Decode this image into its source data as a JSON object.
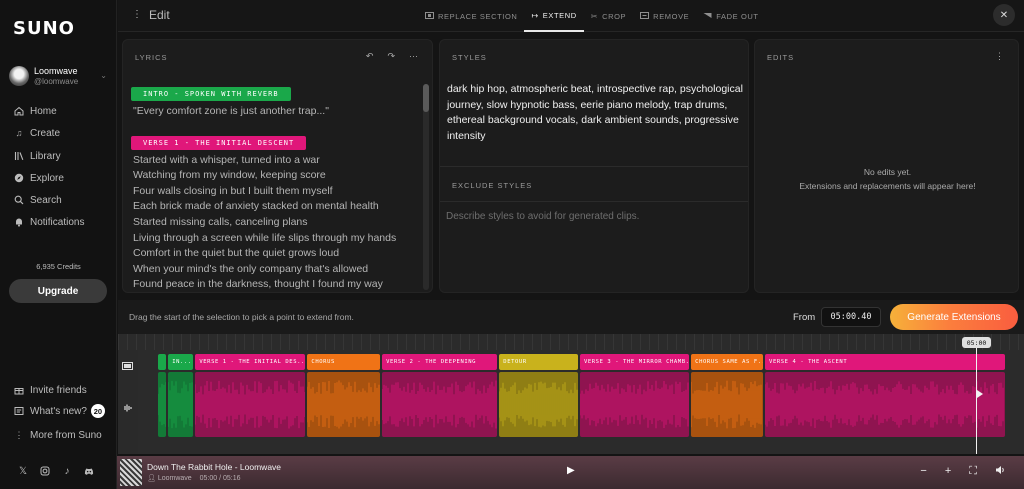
{
  "app": {
    "logo": "SUNO"
  },
  "profile": {
    "name": "Loomwave",
    "handle": "@loomwave"
  },
  "nav": [
    {
      "label": "Home",
      "icon": "home-icon"
    },
    {
      "label": "Create",
      "icon": "music-note-icon"
    },
    {
      "label": "Library",
      "icon": "library-icon"
    },
    {
      "label": "Explore",
      "icon": "compass-icon"
    },
    {
      "label": "Search",
      "icon": "search-icon"
    },
    {
      "label": "Notifications",
      "icon": "bell-icon"
    }
  ],
  "credits": "6,935 Credits",
  "upgrade_label": "Upgrade",
  "footer_nav": {
    "invite": "Invite friends",
    "whats_new": "What's new?",
    "whats_new_count": "20",
    "more": "More from Suno"
  },
  "topbar": {
    "title": "Edit",
    "tabs": [
      {
        "label": "REPLACE SECTION",
        "icon": "replace-icon",
        "active": false
      },
      {
        "label": "EXTEND",
        "icon": "extend-icon",
        "active": true
      },
      {
        "label": "CROP",
        "icon": "crop-icon",
        "active": false
      },
      {
        "label": "REMOVE",
        "icon": "remove-icon",
        "active": false
      },
      {
        "label": "FADE OUT",
        "icon": "fade-icon",
        "active": false
      }
    ]
  },
  "lyrics": {
    "header": "LYRICS",
    "blocks": [
      {
        "tag": "INTRO - SPOKEN WITH REVERB",
        "color": "#1aa84a",
        "lines": [
          "\"Every comfort zone is just another trap...\""
        ]
      },
      {
        "tag": "VERSE 1 - THE INITIAL DESCENT",
        "color": "#e0177a",
        "lines": [
          "Started with a whisper, turned into a war",
          "Watching from my window, keeping score",
          "Four walls closing in but I built them myself",
          "Each brick made of anxiety stacked on mental health",
          "Started missing calls, canceling plans",
          "Living through a screen while life slips through my hands",
          "Comfort in the quiet but the quiet grows loud",
          "When your mind's the only company that's allowed",
          "Found peace in the darkness, thought I found my way"
        ]
      }
    ]
  },
  "styles": {
    "header": "STYLES",
    "text": "dark hip hop, atmospheric beat, introspective rap, psychological journey, slow hypnotic bass, eerie piano melody, trap drums, ethereal background vocals, dark ambient sounds, progressive intensity",
    "exclude_header": "EXCLUDE STYLES",
    "exclude_placeholder": "Describe styles to avoid for generated clips."
  },
  "edits": {
    "header": "EDITS",
    "empty_line1": "No edits yet.",
    "empty_line2": "Extensions and replacements will appear here!"
  },
  "extend": {
    "hint": "Drag the start of the selection to pick a point to extend from.",
    "from_label": "From",
    "from_value": "05:00.40",
    "button": "Generate Extensions"
  },
  "timeline": {
    "playhead_label": "05:00",
    "segments": [
      {
        "label": "",
        "color": "#1aa84a",
        "wave": "#137a37",
        "start": 0.0,
        "end": 0.012
      },
      {
        "label": "IN...",
        "color": "#1aa84a",
        "wave": "#137a37",
        "start": 0.012,
        "end": 0.044
      },
      {
        "label": "VERSE 1 - THE INITIAL DES...",
        "color": "#e0177a",
        "wave": "#8f1450",
        "start": 0.044,
        "end": 0.176
      },
      {
        "label": "CHORUS",
        "color": "#f07316",
        "wave": "#a8520f",
        "start": 0.176,
        "end": 0.264
      },
      {
        "label": "VERSE 2 - THE DEEPENING",
        "color": "#e0177a",
        "wave": "#8f1450",
        "start": 0.264,
        "end": 0.402
      },
      {
        "label": "DETOUR",
        "color": "#c9b21c",
        "wave": "#8f7e14",
        "start": 0.402,
        "end": 0.497
      },
      {
        "label": "VERSE 3 - THE MIRROR CHAMB...",
        "color": "#e0177a",
        "wave": "#8f1450",
        "start": 0.497,
        "end": 0.628
      },
      {
        "label": "CHORUS SAME AS F...",
        "color": "#f07316",
        "wave": "#a8520f",
        "start": 0.628,
        "end": 0.715
      },
      {
        "label": "VERSE 4 - THE ASCENT",
        "color": "#e0177a",
        "wave": "#8f1450",
        "start": 0.715,
        "end": 1.0
      }
    ]
  },
  "player": {
    "title": "Down The Rabbit Hole - Loomwave",
    "artist": "Loomwave",
    "time": "05:00 / 05:16"
  }
}
